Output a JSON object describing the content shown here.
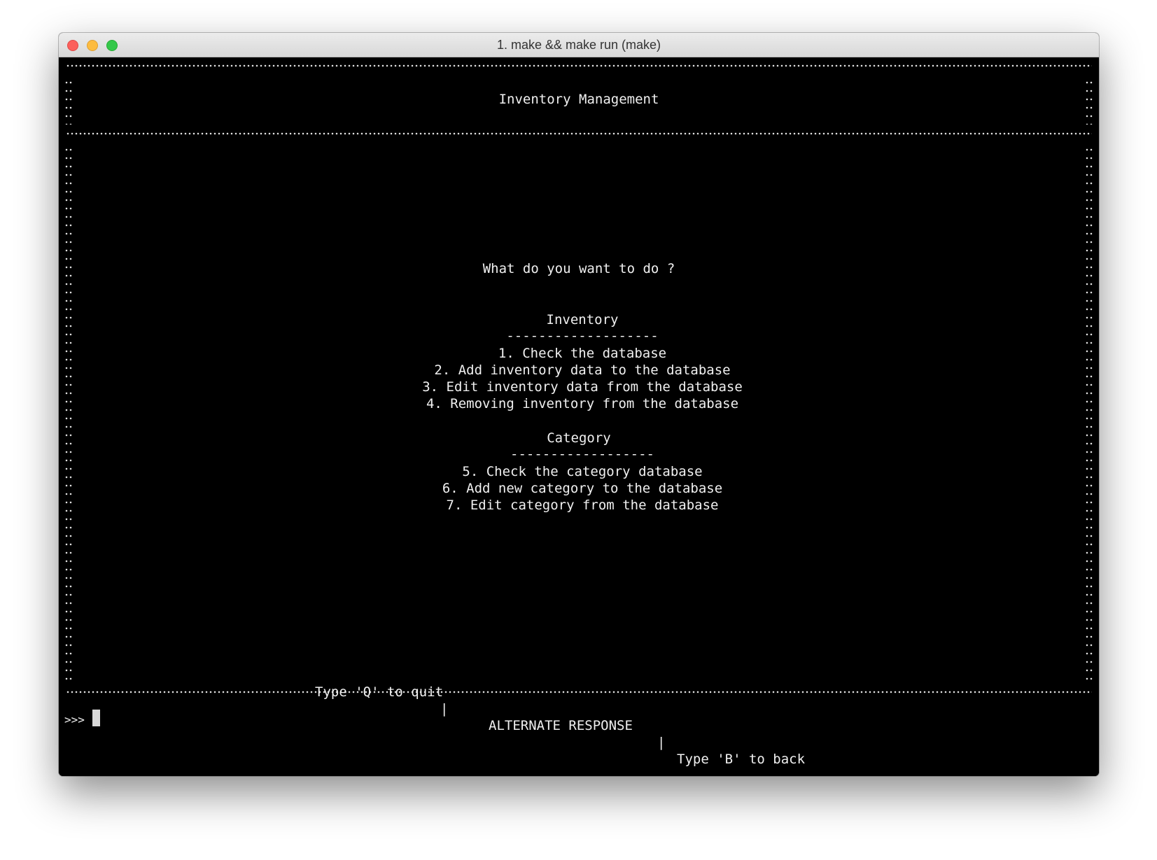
{
  "window": {
    "title": "1. make && make run (make)"
  },
  "terminal": {
    "header": "Inventory Management",
    "question": "What do you want to do ?",
    "inventory_section": {
      "heading": "Inventory",
      "rule": "-------------------",
      "items": [
        "1. Check the database",
        "2. Add inventory data to the database",
        "3. Edit inventory data from the database",
        "4. Removing inventory from the database"
      ]
    },
    "category_section": {
      "heading": "Category",
      "rule": "------------------",
      "items": [
        "5. Check the category database",
        "6. Add new category to the database",
        "7. Edit category from the database"
      ]
    },
    "footer": {
      "quit": "Type 'Q' to quit",
      "sep1": "|",
      "alt": "ALTERNATE RESPONSE",
      "sep2": "|",
      "back": "Type 'B' to back"
    },
    "prompt": ">>>"
  },
  "colors": {
    "background": "#000000",
    "text": "#f0f0f0",
    "titlebar": "#e0e0e0"
  }
}
